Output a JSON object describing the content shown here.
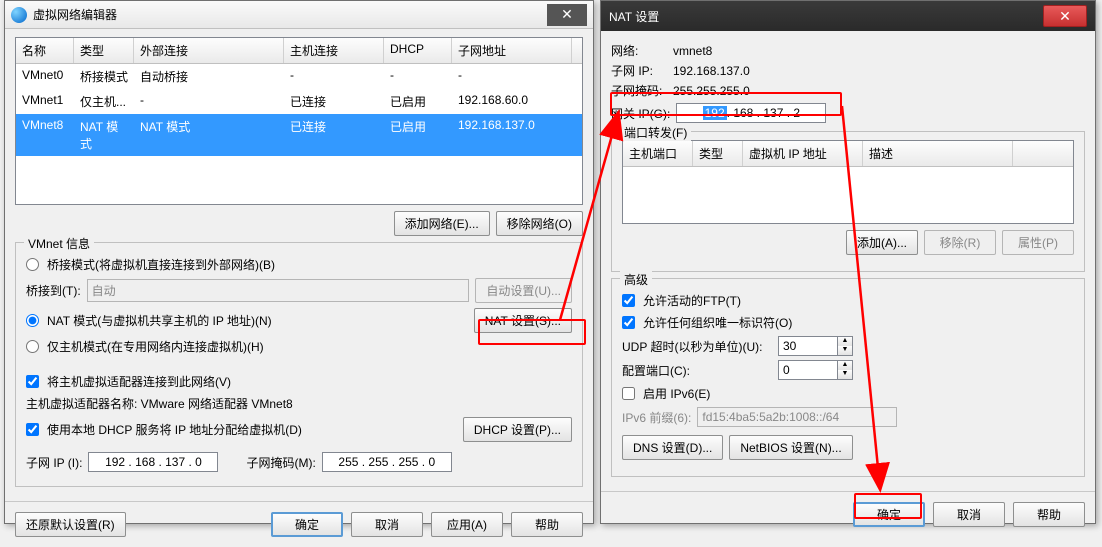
{
  "left": {
    "title": "虚拟网络编辑器",
    "cols": {
      "name": "名称",
      "type": "类型",
      "ext": "外部连接",
      "host": "主机连接",
      "dhcp": "DHCP",
      "subnet": "子网地址"
    },
    "rows": [
      {
        "name": "VMnet0",
        "type": "桥接模式",
        "ext": "自动桥接",
        "host": "-",
        "dhcp": "-",
        "subnet": "-"
      },
      {
        "name": "VMnet1",
        "type": "仅主机...",
        "ext": "-",
        "host": "已连接",
        "dhcp": "已启用",
        "subnet": "192.168.60.0"
      },
      {
        "name": "VMnet8",
        "type": "NAT 模式",
        "ext": "NAT 模式",
        "host": "已连接",
        "dhcp": "已启用",
        "subnet": "192.168.137.0"
      }
    ],
    "btn_add_net": "添加网络(E)...",
    "btn_remove_net": "移除网络(O)",
    "info_title": "VMnet 信息",
    "radio_bridge": "桥接模式(将虚拟机直接连接到外部网络)(B)",
    "bridge_to": "桥接到(T):",
    "bridge_auto_value": "自动",
    "btn_auto_set": "自动设置(U)...",
    "radio_nat": "NAT 模式(与虚拟机共享主机的 IP 地址)(N)",
    "btn_nat_settings": "NAT 设置(S)...",
    "radio_hostonly": "仅主机模式(在专用网络内连接虚拟机)(H)",
    "chk_connect_host": "将主机虚拟适配器连接到此网络(V)",
    "adapter_label": "主机虚拟适配器名称: VMware 网络适配器 VMnet8",
    "chk_dhcp": "使用本地 DHCP 服务将 IP 地址分配给虚拟机(D)",
    "btn_dhcp_settings": "DHCP 设置(P)...",
    "subnet_ip_label": "子网 IP (I):",
    "subnet_ip_value": "192 . 168 . 137 . 0",
    "subnet_mask_label": "子网掩码(M):",
    "subnet_mask_value": "255 . 255 . 255 . 0",
    "btn_restore": "还原默认设置(R)",
    "btn_ok": "确定",
    "btn_cancel": "取消",
    "btn_apply": "应用(A)",
    "btn_help": "帮助"
  },
  "right": {
    "title": "NAT 设置",
    "net_label": "网络:",
    "net_value": "vmnet8",
    "subnetip_label": "子网 IP:",
    "subnetip_value": "192.168.137.0",
    "mask_label": "子网掩码:",
    "mask_value": "255.255.255.0",
    "gateway_label": "网关 IP(G):",
    "gateway_oct1": "192",
    "gateway_rest": " . 168 . 137 .  2",
    "pf_title": "端口转发(F)",
    "pf_cols": {
      "hostport": "主机端口",
      "type": "类型",
      "vmip": "虚拟机 IP 地址",
      "desc": "描述"
    },
    "btn_add": "添加(A)...",
    "btn_remove": "移除(R)",
    "btn_props": "属性(P)",
    "adv_title": "高级",
    "chk_ftp": "允许活动的FTP(T)",
    "chk_org": "允许任何组织唯一标识符(O)",
    "udp_label": "UDP 超时(以秒为单位)(U):",
    "udp_value": "30",
    "cfg_port_label": "配置端口(C):",
    "cfg_port_value": "0",
    "chk_ipv6": "启用 IPv6(E)",
    "ipv6_prefix_label": "IPv6 前缀(6):",
    "ipv6_prefix_value": "fd15:4ba5:5a2b:1008::/64",
    "btn_dns": "DNS 设置(D)...",
    "btn_netbios": "NetBIOS 设置(N)...",
    "btn_ok": "确定",
    "btn_cancel": "取消",
    "btn_help": "帮助"
  },
  "watermark": ""
}
